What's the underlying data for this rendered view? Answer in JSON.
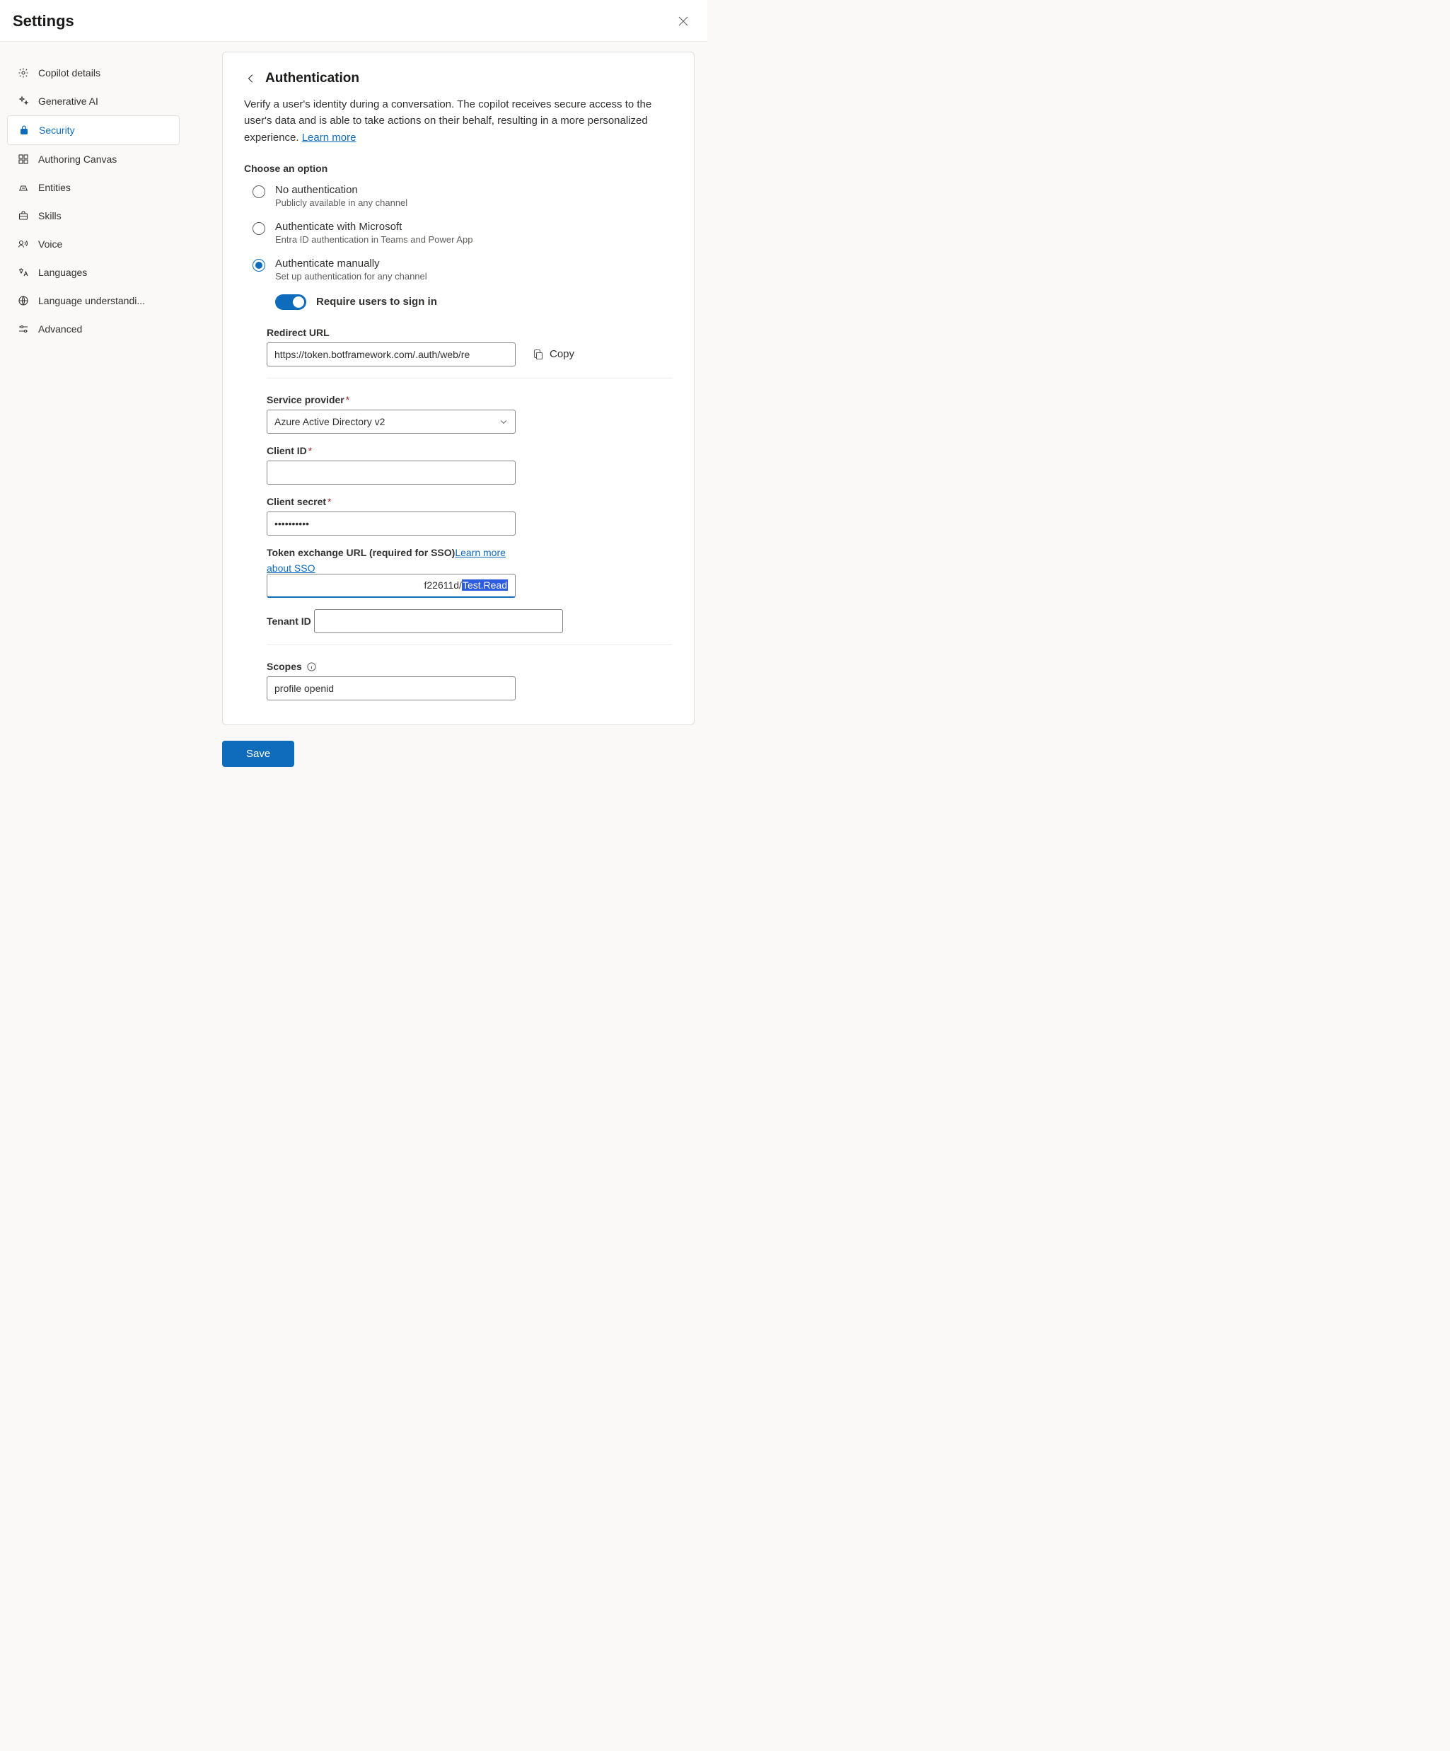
{
  "header": {
    "title": "Settings",
    "close_label": "Close"
  },
  "sidebar": {
    "items": [
      {
        "label": "Copilot details",
        "selected": false
      },
      {
        "label": "Generative AI",
        "selected": false
      },
      {
        "label": "Security",
        "selected": true
      },
      {
        "label": "Authoring Canvas",
        "selected": false
      },
      {
        "label": "Entities",
        "selected": false
      },
      {
        "label": "Skills",
        "selected": false
      },
      {
        "label": "Voice",
        "selected": false
      },
      {
        "label": "Languages",
        "selected": false
      },
      {
        "label": "Language understandi...",
        "selected": false
      },
      {
        "label": "Advanced",
        "selected": false
      }
    ]
  },
  "auth": {
    "title": "Authentication",
    "description_prefix": "Verify a user's identity during a conversation. The copilot receives secure access to the user's data and is able to take actions on their behalf, resulting in a more personalized experience. ",
    "learn_more": "Learn more",
    "choose_label": "Choose an option",
    "options": [
      {
        "title": "No authentication",
        "sub": "Publicly available in any channel"
      },
      {
        "title": "Authenticate with Microsoft",
        "sub": "Entra ID authentication in Teams and Power App"
      },
      {
        "title": "Authenticate manually",
        "sub": "Set up authentication for any channel"
      }
    ],
    "toggle_label": "Require users to sign in",
    "redirect": {
      "label": "Redirect URL",
      "value": "https://token.botframework.com/.auth/web/re",
      "copy": "Copy"
    },
    "service_provider": {
      "label": "Service provider",
      "value": "Azure Active Directory v2"
    },
    "client_id": {
      "label": "Client ID",
      "value": ""
    },
    "client_secret": {
      "label": "Client secret",
      "value": "••••••••••"
    },
    "token_exchange": {
      "label": "Token exchange URL (required for SSO) ",
      "link": "Learn more about SSO",
      "plain": "f22611d/",
      "selected": "Test.Read"
    },
    "tenant_id": {
      "label": "Tenant ID",
      "value": ""
    },
    "scopes": {
      "label": "Scopes",
      "value": "profile openid"
    }
  },
  "footer": {
    "save": "Save"
  }
}
